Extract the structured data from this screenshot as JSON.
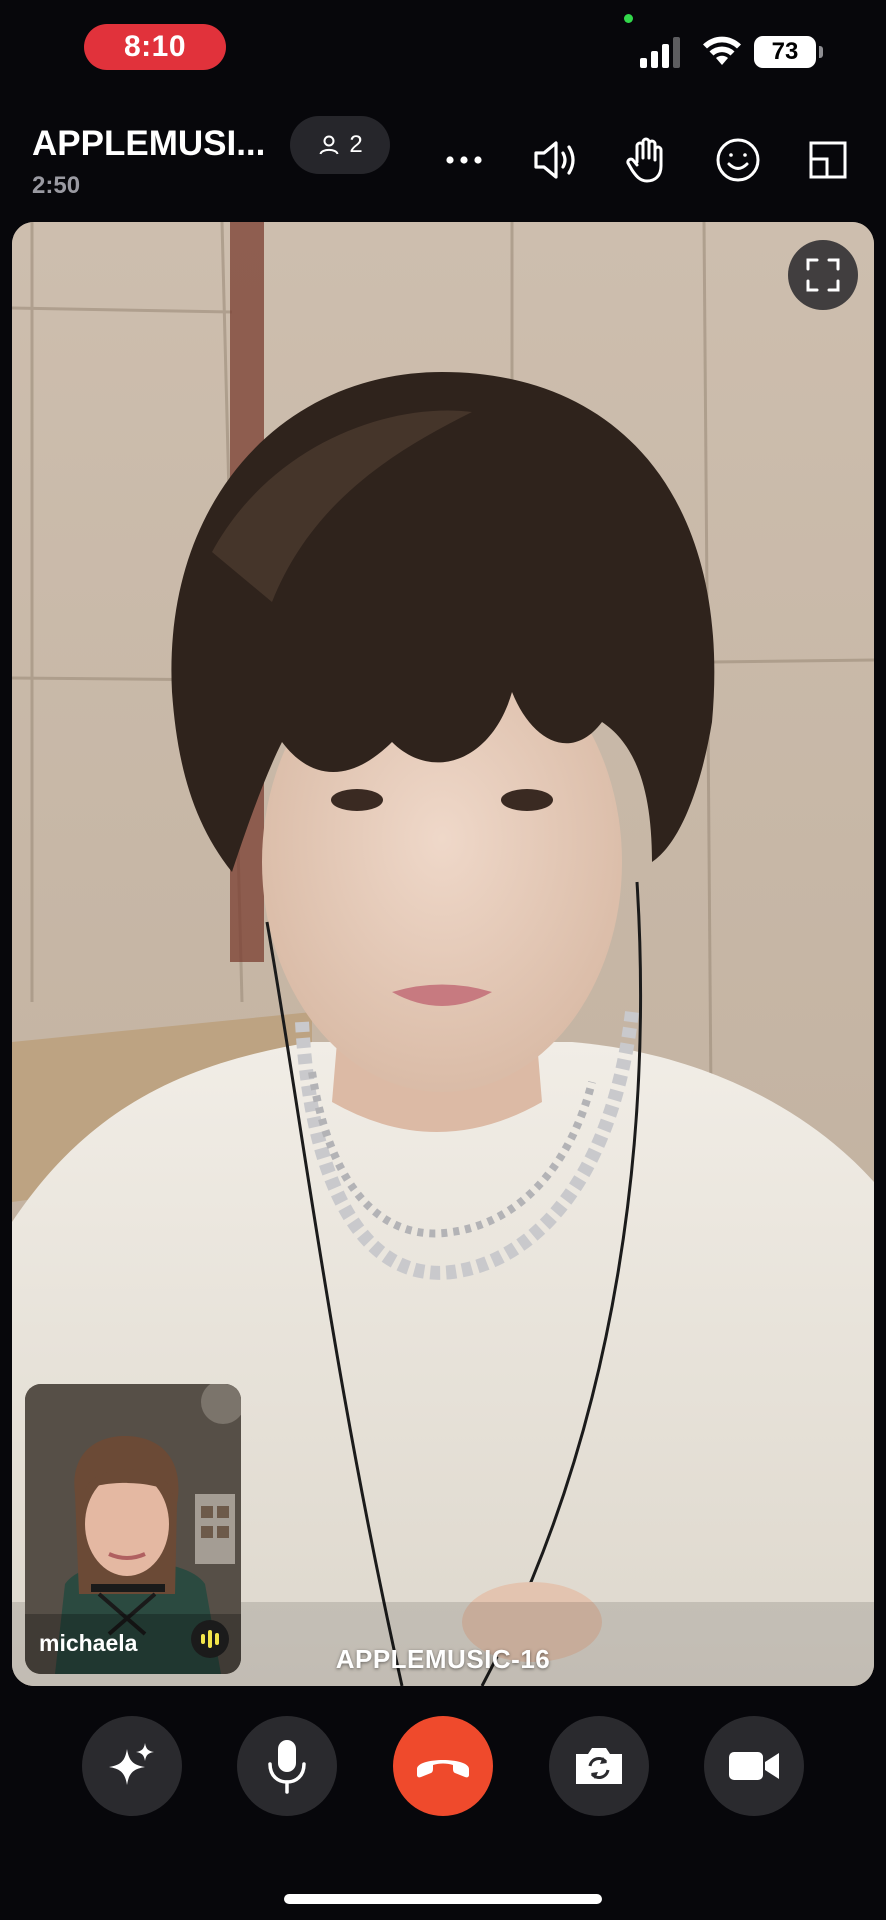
{
  "status_bar": {
    "time": "8:10",
    "battery": "73",
    "colors": {
      "time_pill": "#e1323b",
      "mic_in_use_dot": "#32d74b"
    }
  },
  "call": {
    "title": "APPLEMUSI...",
    "duration": "2:50",
    "participant_count": "2"
  },
  "header_actions": [
    "more-icon",
    "speaker-icon",
    "raise-hand-icon",
    "reactions-icon",
    "layout-icon"
  ],
  "remote": {
    "name": "APPLEMUSIC-16"
  },
  "self": {
    "name": "michaela"
  },
  "controls": [
    "effects-sparkle-icon",
    "microphone-icon",
    "end-call-icon",
    "flip-camera-icon",
    "video-camera-icon"
  ],
  "colors": {
    "end_call": "#ef4a2c",
    "control_bg": "#2a2a2e",
    "speaking_indicator": "#f4e64a"
  }
}
